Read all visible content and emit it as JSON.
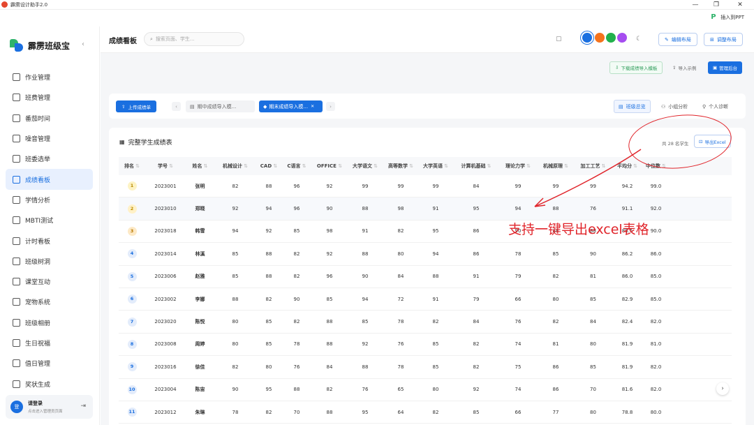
{
  "window": {
    "title": "霹雳设计助手2.0",
    "controls": [
      "—",
      "❐",
      "✕"
    ]
  },
  "ppt_button": "插入到PPT",
  "brand": {
    "name": "霹雳班级宝"
  },
  "sidebar": {
    "items": [
      {
        "label": "作业管理",
        "icon": "book-icon"
      },
      {
        "label": "班费管理",
        "icon": "wallet-icon"
      },
      {
        "label": "番茄时间",
        "icon": "timer-icon"
      },
      {
        "label": "噪音管理",
        "icon": "sound-wave-icon"
      },
      {
        "label": "班委选举",
        "icon": "ballot-icon"
      },
      {
        "label": "成绩看板",
        "icon": "grade-board-icon",
        "active": true
      },
      {
        "label": "学情分析",
        "icon": "line-chart-icon"
      },
      {
        "label": "MBTI测试",
        "icon": "target-icon"
      },
      {
        "label": "计时看板",
        "icon": "stopwatch-icon"
      },
      {
        "label": "班级树洞",
        "icon": "chat-bubble-icon"
      },
      {
        "label": "课堂互动",
        "icon": "interaction-icon"
      },
      {
        "label": "宠物系统",
        "icon": "paw-icon"
      },
      {
        "label": "班级相册",
        "icon": "photo-icon"
      },
      {
        "label": "生日祝福",
        "icon": "cake-icon"
      },
      {
        "label": "值日管理",
        "icon": "calendar-icon"
      },
      {
        "label": "奖状生成",
        "icon": "award-icon"
      }
    ]
  },
  "user": {
    "avatar": "登",
    "title": "请登录",
    "subtitle": "点击进入管理员页面"
  },
  "header": {
    "title": "成绩看板",
    "search_placeholder": "搜索页面、学生...",
    "edit_layout": "编辑布局",
    "adjust_layout": "调整布局"
  },
  "theme_colors": [
    "#1a6fe0",
    "#f5731d",
    "#22b14c",
    "#a64df0"
  ],
  "actions": {
    "download_template": "下载成绩导入模板",
    "import_example": "导入示例",
    "admin": "管理后台"
  },
  "tabs": {
    "upload": "上传成绩单",
    "midterm": "期中成绩导入模...",
    "final": "期末成绩导入模..."
  },
  "views": {
    "overview": "班级总览",
    "group": "小组分析",
    "personal": "个人诊断"
  },
  "table": {
    "title": "完整学生成绩表",
    "count": "共 28 名学生",
    "export": "导出Excel",
    "headers": [
      "排名",
      "学号",
      "姓名",
      "机械设计",
      "CAD",
      "C语言",
      "OFFICE",
      "大学语文",
      "高等数学",
      "大学英语",
      "计算机基础",
      "理论力学",
      "机械原理",
      "加工工艺",
      "平均分",
      "中位数"
    ],
    "rows": [
      [
        "1",
        "2023001",
        "张明",
        "82",
        "88",
        "96",
        "92",
        "99",
        "99",
        "99",
        "84",
        "99",
        "99",
        "99",
        "94.2",
        "99.0"
      ],
      [
        "2",
        "2023010",
        "郑晓",
        "92",
        "94",
        "96",
        "90",
        "88",
        "98",
        "91",
        "95",
        "94",
        "88",
        "76",
        "91.1",
        "92.0"
      ],
      [
        "3",
        "2023018",
        "韩雪",
        "94",
        "92",
        "85",
        "98",
        "91",
        "82",
        "95",
        "86",
        "90",
        "88",
        "88",
        "88.5",
        "90.0"
      ],
      [
        "4",
        "2023014",
        "林溪",
        "85",
        "88",
        "82",
        "92",
        "88",
        "80",
        "94",
        "86",
        "78",
        "85",
        "90",
        "86.2",
        "86.0"
      ],
      [
        "5",
        "2023006",
        "赵雅",
        "85",
        "88",
        "82",
        "96",
        "90",
        "84",
        "88",
        "91",
        "79",
        "82",
        "81",
        "86.0",
        "85.0"
      ],
      [
        "6",
        "2023002",
        "李娜",
        "88",
        "82",
        "90",
        "85",
        "94",
        "72",
        "91",
        "79",
        "66",
        "80",
        "85",
        "82.9",
        "85.0"
      ],
      [
        "7",
        "2023020",
        "陈悦",
        "80",
        "85",
        "82",
        "88",
        "85",
        "78",
        "82",
        "84",
        "76",
        "82",
        "84",
        "82.4",
        "82.0"
      ],
      [
        "8",
        "2023008",
        "周婷",
        "80",
        "85",
        "78",
        "88",
        "92",
        "76",
        "85",
        "82",
        "74",
        "81",
        "80",
        "81.9",
        "81.0"
      ],
      [
        "9",
        "2023016",
        "徐佳",
        "82",
        "80",
        "76",
        "84",
        "88",
        "78",
        "85",
        "82",
        "75",
        "86",
        "85",
        "81.9",
        "82.0"
      ],
      [
        "10",
        "2023004",
        "陈宙",
        "90",
        "95",
        "88",
        "82",
        "76",
        "65",
        "80",
        "92",
        "74",
        "86",
        "70",
        "81.6",
        "82.0"
      ],
      [
        "11",
        "2023012",
        "朱琳",
        "78",
        "82",
        "70",
        "88",
        "95",
        "64",
        "82",
        "85",
        "66",
        "77",
        "80",
        "78.8",
        "80.0"
      ]
    ]
  },
  "annotation": "支持一键导出excel表格"
}
